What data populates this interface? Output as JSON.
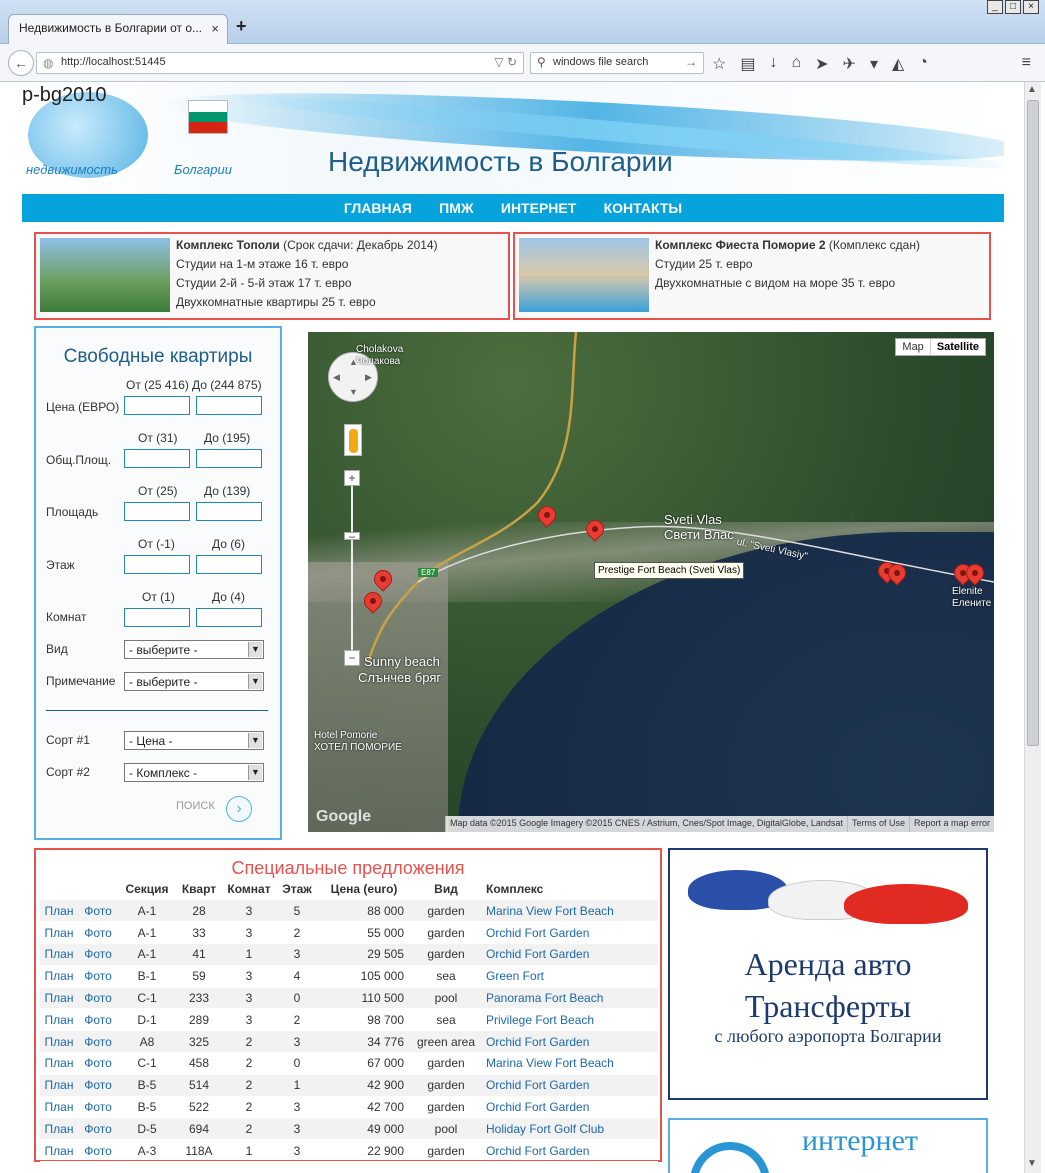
{
  "browser": {
    "tab_title": "Недвижимость в Болгарии от о...",
    "url": "http://localhost:51445",
    "search_value": "windows file search"
  },
  "header": {
    "logo_text": "p-bg2010",
    "logo_sub1": "недвижимость",
    "logo_sub2": "Болгарии",
    "site_title": "Недвижимость в Болгарии"
  },
  "nav": [
    "ГЛАВНАЯ",
    "ПМЖ",
    "ИНТЕРНЕТ",
    "КОНТАКТЫ"
  ],
  "promos": [
    {
      "title": "Комплекс Тополи",
      "note": " (Срок сдачи: Декабрь 2014)",
      "lines": [
        "Студии на 1-м этаже 16 т. евро",
        "Студии 2-й - 5-й этаж 17 т. евро",
        "Двухкомнатные квартиры 25 т. евро"
      ]
    },
    {
      "title": "Комплекс Фиеста Помоpие 2",
      "note": " (Комплекс сдан)",
      "lines": [
        "Студии 25 т. евро",
        "Двухкомнатные с видом на море 35 т. евро"
      ]
    }
  ],
  "search": {
    "title": "Свободные квартиры",
    "price": {
      "label": "Цена (ЕВРО)",
      "from": "От (25 416)",
      "to": "До (244 875)"
    },
    "total_area": {
      "label": "Общ.Площ.",
      "from": "От (31)",
      "to": "До (195)"
    },
    "area": {
      "label": "Площадь",
      "from": "От (25)",
      "to": "До (139)"
    },
    "floor": {
      "label": "Этаж",
      "from": "От (-1)",
      "to": "До (6)"
    },
    "rooms": {
      "label": "Комнат",
      "from": "От (1)",
      "to": "До (4)"
    },
    "view": {
      "label": "Вид",
      "value": "- выберите -"
    },
    "note": {
      "label": "Примечание",
      "value": "- выберите -"
    },
    "sort1": {
      "label": "Сорт #1",
      "value": "- Цена -"
    },
    "sort2": {
      "label": "Сорт #2",
      "value": "- Комплекс -"
    },
    "button": "ПОИСК"
  },
  "map": {
    "type_map": "Map",
    "type_satellite": "Satellite",
    "labels": {
      "cholakova": "Cholakova",
      "cholakova2": "Чолакова",
      "sveti_vlas": "Sveti Vlas",
      "sveti_vlas_cyr": "Свети Влас",
      "street": "ul. \"Sveti Vlasiy\"",
      "sunny": "Sunny beach",
      "sunny_cyr": "Слънчев бряг",
      "pomorie": "Hotel Pomorie",
      "pomorie_cyr": "ХОТЕЛ ПОМОРИЕ",
      "elenite": "Elenite",
      "elenite_cyr": "Елените",
      "road": "E87"
    },
    "tooltip": "Prestige Fort Beach (Sveti Vlas)",
    "attribution": "Map data ©2015 Google Imagery ©2015 CNES / Astrium, Cnes/Spot Image, DigitalGlobe, Landsat",
    "terms": "Terms of Use",
    "report": "Report a map error",
    "google": "Google"
  },
  "specials": {
    "title": "Специальные предложения",
    "headers": [
      "",
      "",
      "Секция",
      "Кварт",
      "Комнат",
      "Этаж",
      "Цена (euro)",
      "Вид",
      "Комплекс"
    ],
    "plan": "План",
    "photo": "Фото",
    "rows": [
      [
        "А-1",
        "28",
        "3",
        "5",
        "88 000",
        "garden",
        "Marina View Fort Beach"
      ],
      [
        "А-1",
        "33",
        "3",
        "2",
        "55 000",
        "garden",
        "Orchid Fort Garden"
      ],
      [
        "А-1",
        "41",
        "1",
        "3",
        "29 505",
        "garden",
        "Orchid Fort Garden"
      ],
      [
        "В-1",
        "59",
        "3",
        "4",
        "105 000",
        "sea",
        "Green Fort"
      ],
      [
        "С-1",
        "233",
        "3",
        "0",
        "110 500",
        "pool",
        "Panorama Fort Beach"
      ],
      [
        "D-1",
        "289",
        "3",
        "2",
        "98 700",
        "sea",
        "Privilege Fort Beach"
      ],
      [
        "А8",
        "325",
        "2",
        "3",
        "34 776",
        "green area",
        "Orchid Fort Garden"
      ],
      [
        "С-1",
        "458",
        "2",
        "0",
        "67 000",
        "garden",
        "Marina View Fort Beach"
      ],
      [
        "В-5",
        "514",
        "2",
        "1",
        "42 900",
        "garden",
        "Orchid Fort Garden"
      ],
      [
        "В-5",
        "522",
        "2",
        "3",
        "42 700",
        "garden",
        "Orchid Fort Garden"
      ],
      [
        "D-5",
        "694",
        "2",
        "3",
        "49 000",
        "pool",
        "Holiday Fort Golf Club"
      ],
      [
        "А-3",
        "118А",
        "1",
        "3",
        "22 900",
        "garden",
        "Orchid Fort Garden"
      ]
    ]
  },
  "ads": {
    "rent_title1": "Аренда авто",
    "rent_title2": "Трансферты",
    "rent_sub": "с любого аэропорта Болгарии",
    "internet": "интернет"
  }
}
